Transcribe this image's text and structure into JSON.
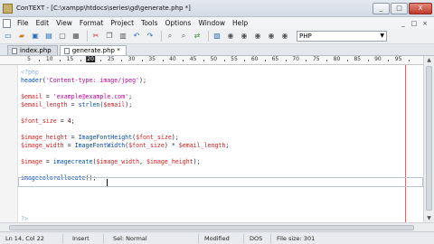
{
  "window": {
    "title": "ConTEXT - [C:\\xampp\\htdocs\\series\\gd\\generate.php *]",
    "controls": [
      "_",
      "□",
      "X"
    ]
  },
  "menubar": {
    "items": [
      "File",
      "Edit",
      "View",
      "Format",
      "Project",
      "Tools",
      "Options",
      "Window",
      "Help"
    ],
    "right_controls": [
      "_",
      "□",
      "×"
    ]
  },
  "toolbar": {
    "highlighter_value": "PHP"
  },
  "tabs": [
    {
      "label": "index.php",
      "active": false
    },
    {
      "label": "generate.php *",
      "active": true
    }
  ],
  "ruler": {
    "labels": [
      "5",
      "10",
      "15",
      "20",
      "25",
      "30",
      "35",
      "40",
      "45",
      "50",
      "55",
      "60",
      "65",
      "70",
      "75",
      "80",
      "85",
      "90",
      "95"
    ],
    "highlighted": "20"
  },
  "code": {
    "lines": [
      "<?php",
      "header('Content-type: image/jpeg');",
      "",
      "$email = 'example@example.com';",
      "$email_length = strlen($email);",
      "",
      "$font_size = 4;",
      "",
      "$image_height = ImageFontHeight($font_size);",
      "$image_width = ImageFontWidth($font_size) * $email_length;",
      "",
      "$image = imagecreate($image_width, $image_height);",
      "",
      "imagecolorallocate();",
      "",
      "",
      "",
      "",
      "?>"
    ]
  },
  "statusbar": {
    "position": "Ln 14, Col 22",
    "mode": "Insert",
    "selection": "Sel: Normal",
    "state": "Modified",
    "format": "DOS",
    "filesize": "File size: 301"
  },
  "colors": {
    "function": "#004bbb",
    "string": "#c0009a",
    "variable": "#d11f1f",
    "margin": "#ff5a5a"
  }
}
